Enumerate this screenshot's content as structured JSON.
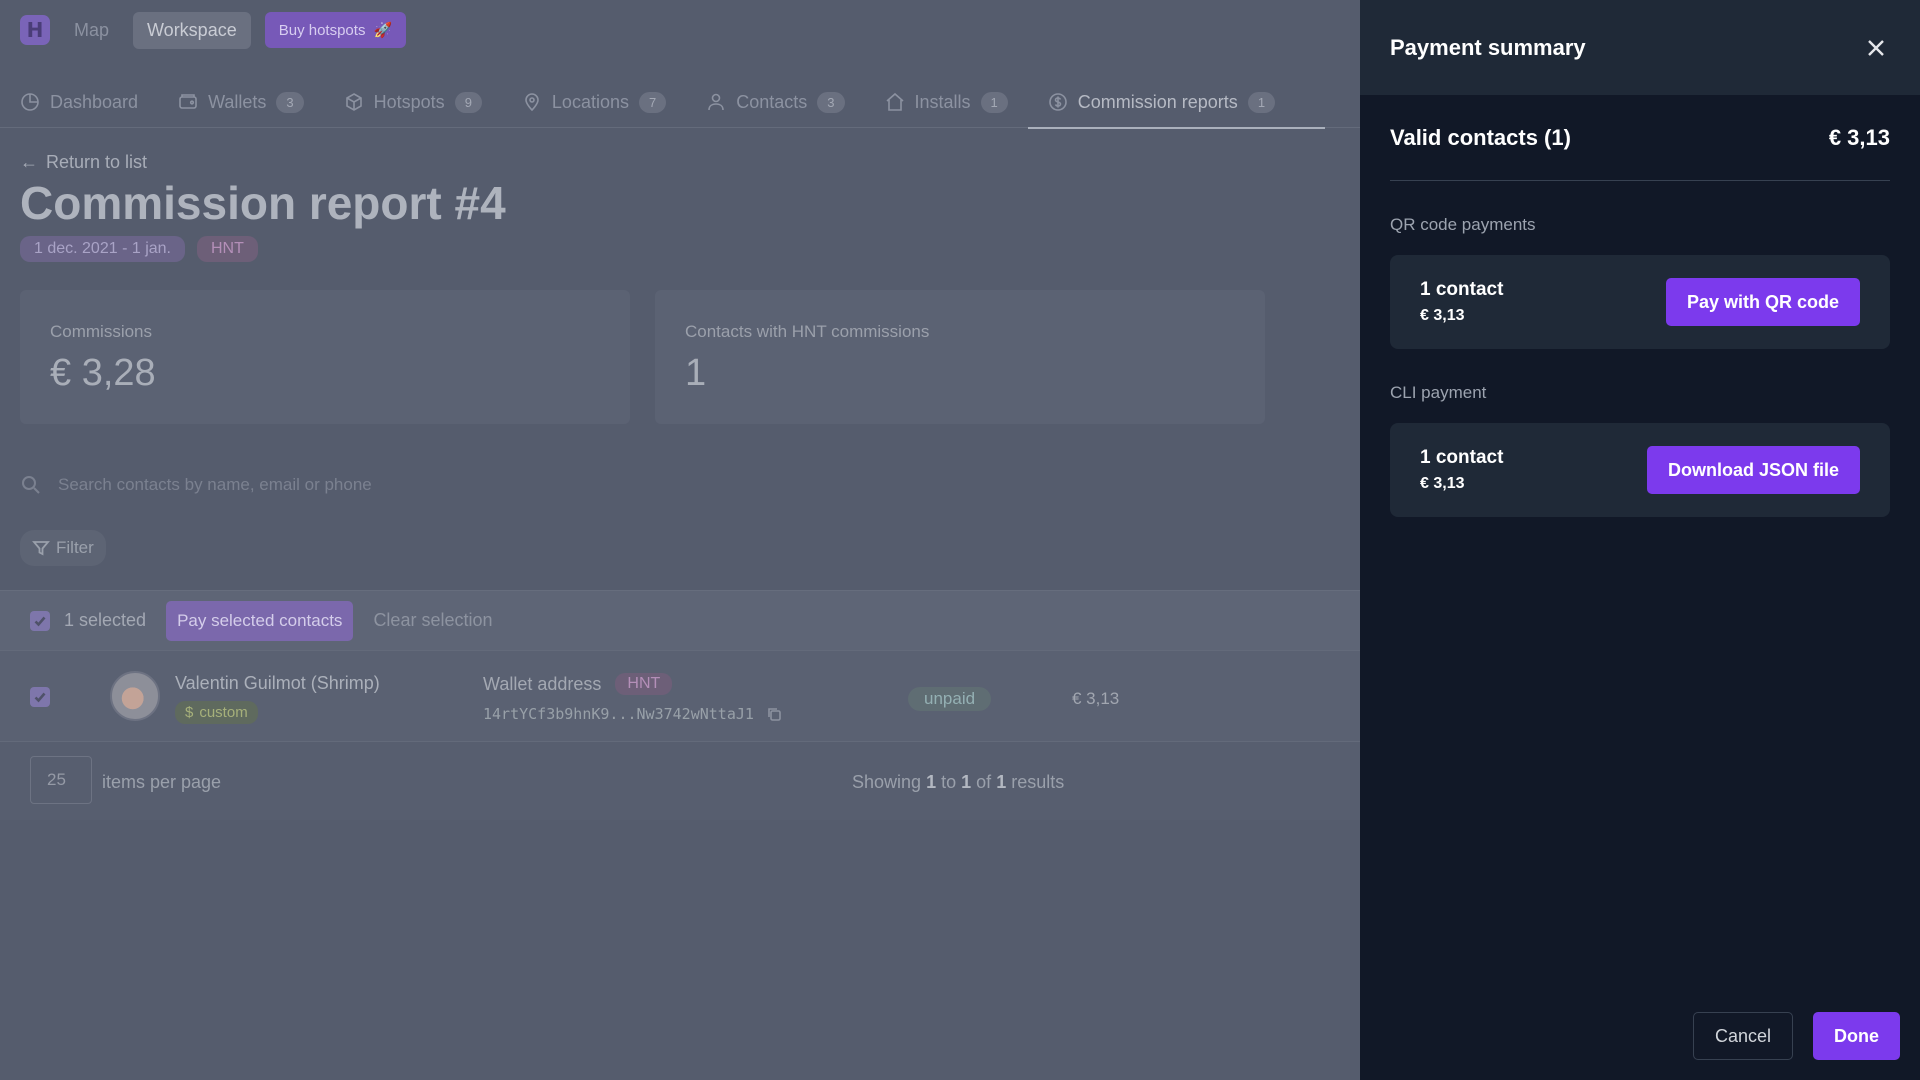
{
  "topbar": {
    "logo_letter": "H",
    "map": "Map",
    "workspace": "Workspace",
    "buy_hotspots": "Buy hotspots",
    "buy_icon": "rocket-icon"
  },
  "tabs": [
    {
      "label": "Dashboard",
      "icon": "dashboard-icon",
      "count": null
    },
    {
      "label": "Wallets",
      "icon": "wallet-icon",
      "count": "3"
    },
    {
      "label": "Hotspots",
      "icon": "cube-icon",
      "count": "9"
    },
    {
      "label": "Locations",
      "icon": "location-pin-icon",
      "count": "7"
    },
    {
      "label": "Contacts",
      "icon": "user-icon",
      "count": "3"
    },
    {
      "label": "Installs",
      "icon": "home-icon",
      "count": "1"
    },
    {
      "label": "Commission reports",
      "icon": "dollar-circle-icon",
      "count": "1",
      "active": true
    }
  ],
  "page": {
    "back_link": "Return to list",
    "title": "Commission report #4",
    "date_range": "1 dec. 2021 - 1 jan.",
    "currency": "HNT"
  },
  "stats": {
    "commissions_label": "Commissions",
    "commissions_value": "€ 3,28",
    "contacts_label": "Contacts with HNT commissions",
    "contacts_value": "1"
  },
  "search": {
    "placeholder": "Search contacts by name, email or phone"
  },
  "filter": {
    "label": "Filter"
  },
  "selection": {
    "count_text": "1 selected",
    "pay_selected": "Pay selected contacts",
    "clear": "Clear selection"
  },
  "rows": [
    {
      "name": "Valentin Guilmot (Shrimp)",
      "tag": "custom",
      "wallet_label": "Wallet address",
      "wallet_currency": "HNT",
      "wallet_address": "14rtYCf3b9hnK9...Nw3742wNttaJ1",
      "status": "unpaid",
      "amount": "€ 3,13"
    }
  ],
  "pagination": {
    "per_page": "25",
    "per_page_label": "items per page",
    "showing": "Showing",
    "from": "1",
    "to_word": "to",
    "to": "1",
    "of_word": "of",
    "total": "1",
    "results_word": "results"
  },
  "panel": {
    "title": "Payment summary",
    "valid_label": "Valid contacts (1)",
    "valid_amount": "€ 3,13",
    "qr_section": "QR code payments",
    "qr_count": "1 contact",
    "qr_amount": "€ 3,13",
    "qr_button": "Pay with QR code",
    "cli_section": "CLI payment",
    "cli_count": "1 contact",
    "cli_amount": "€ 3,13",
    "cli_button": "Download JSON file",
    "cancel": "Cancel",
    "done": "Done"
  },
  "colors": {
    "accent": "#7c3aed",
    "panel_bg": "#111827",
    "panel_card": "#1f2937",
    "overlay_bg": "#555c6d"
  }
}
